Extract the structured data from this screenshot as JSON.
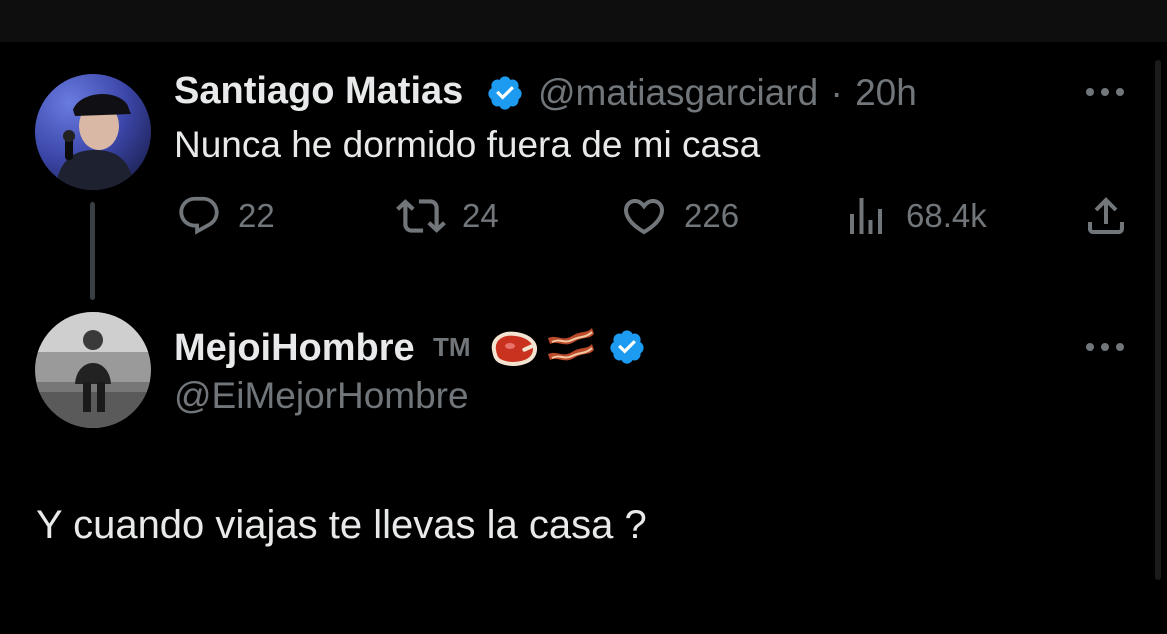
{
  "tweet": {
    "author_name": "Santiago Matias",
    "handle": "@matiasgarciard",
    "separator": "·",
    "time": "20h",
    "text": "Nunca he dormido fuera de mi casa",
    "verified": true,
    "actions": {
      "replies": "22",
      "reposts": "24",
      "likes": "226",
      "views": "68.4k"
    }
  },
  "reply": {
    "author_name": "MejoiHombre",
    "trademark": "TM",
    "emojis": [
      "steak-emoji",
      "bacon-emoji"
    ],
    "handle": "@EiMejorHombre",
    "verified": true,
    "text": "Y cuando viajas te llevas la casa ?"
  },
  "colors": {
    "background": "#000000",
    "text_primary": "#e7e9ea",
    "text_secondary": "#71767b",
    "verified_blue": "#1d9bf0",
    "thread_line": "#3a3f43"
  }
}
